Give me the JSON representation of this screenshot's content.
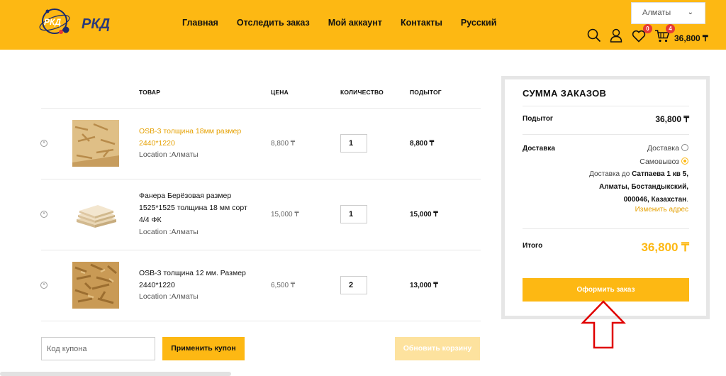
{
  "brand": {
    "name": "РКД",
    "accent": "#FDB813"
  },
  "nav": {
    "items": [
      "Главная",
      "Отследить заказ",
      "Мой аккаунт",
      "Контакты",
      "Русский"
    ]
  },
  "city": {
    "value": "Алматы"
  },
  "header_icons": {
    "search": "search-icon",
    "account": "user-icon",
    "wishlist_count": "0",
    "cart_count": "4",
    "cart_total": "36,800 ₸"
  },
  "table": {
    "headers": {
      "product": "ТОВАР",
      "price": "ЦЕНА",
      "qty": "КОЛИЧЕСТВО",
      "subtotal": "ПОДЫТОГ"
    },
    "rows": [
      {
        "name": "OSB-3 толщина 18мм размер 2440*1220",
        "location": "Location :Алматы",
        "price": "8,800 ₸",
        "qty": "1",
        "subtotal": "8,800 ₸"
      },
      {
        "name": "Фанера Берёзовая размер 1525*1525 толщина 18 мм сорт 4/4 ФК",
        "location": "Location :Алматы",
        "price": "15,000 ₸",
        "qty": "1",
        "subtotal": "15,000 ₸"
      },
      {
        "name": "OSB-3 толщина 12 мм. Размер 2440*1220",
        "location": "Location :Алматы",
        "price": "6,500 ₸",
        "qty": "2",
        "subtotal": "13,000 ₸"
      }
    ]
  },
  "coupon": {
    "placeholder": "Код купона",
    "apply_label": "Применить купон",
    "update_label": "Обновить корзину"
  },
  "summary": {
    "title": "СУММА ЗАКАЗОВ",
    "subtotal_label": "Подытог",
    "subtotal_value": "36,800 ₸",
    "shipping_label": "Доставка",
    "option_delivery": "Доставка",
    "option_pickup": "Самовывоз",
    "ship_to_prefix": "Доставка до",
    "ship_to_address": "Сатпаева 1 кв 5, Алматы, Бостандыкский, 000046, Казахстан",
    "change_address": "Изменить адрес",
    "total_label": "Итого",
    "total_value": "36,800 ₸",
    "checkout_label": "Оформить заказ"
  }
}
